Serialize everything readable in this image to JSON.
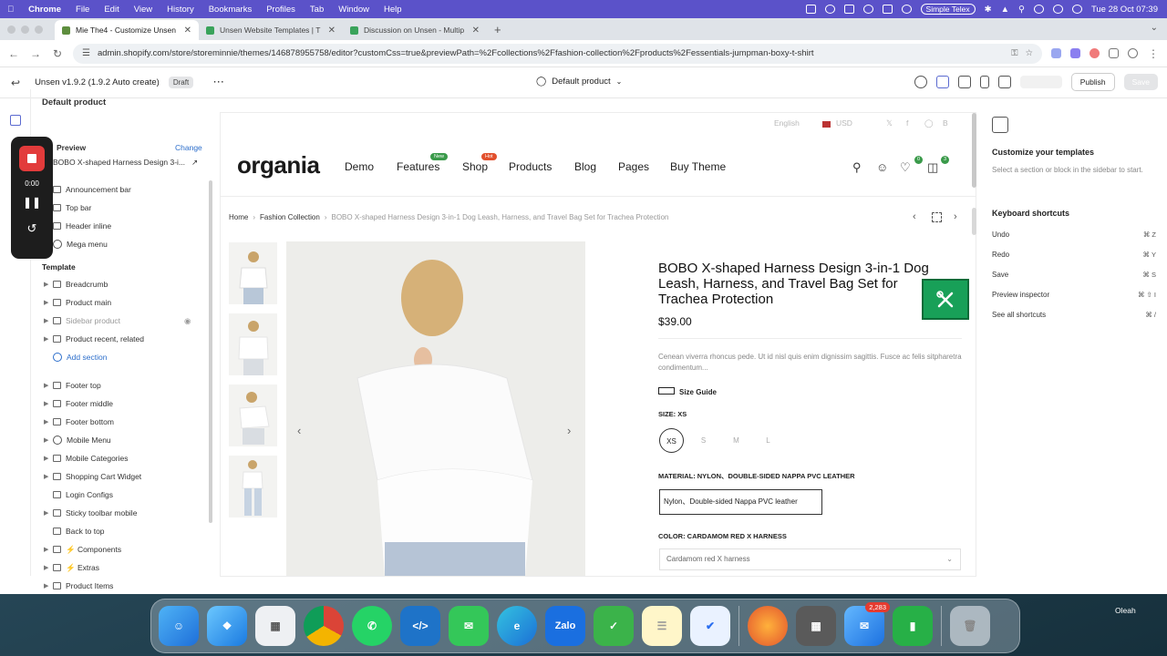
{
  "menubar": {
    "app": "Chrome",
    "items": [
      "File",
      "Edit",
      "View",
      "History",
      "Bookmarks",
      "Profiles",
      "Tab",
      "Window",
      "Help"
    ],
    "input_method": "Simple Telex",
    "datetime": "Tue 28 Oct  07:39"
  },
  "browser": {
    "tabs": [
      {
        "title": "Mie The4 - Customize Unsen",
        "active": true
      },
      {
        "title": "Unsen Website Templates | T",
        "active": false
      },
      {
        "title": "Discussion on Unsen - Multip",
        "active": false
      }
    ],
    "new_tab": "+",
    "url": "admin.shopify.com/store/storeminnie/themes/146878955758/editor?customCss=true&previewPath=%2Fcollections%2Ffashion-collection%2Fproducts%2Fessentials-jumpman-boxy-t-shirt"
  },
  "editor": {
    "theme_name": "Unsen v1.9.2 (1.9.2 Auto create)",
    "draft_badge": "Draft",
    "page_selector": "Default product",
    "publish_label": "Publish",
    "save_label": "Save"
  },
  "left_panel": {
    "title": "Default product",
    "preview_label": "Preview",
    "change_label": "Change",
    "preview_product": "BOBO X-shaped Harness Design 3-i...",
    "recorder_time": "0:00",
    "header_items": [
      "Announcement bar",
      "Top bar",
      "Header inline",
      "Mega menu"
    ],
    "template_label": "Template",
    "template_items": [
      "Breadcrumb",
      "Product main",
      "Sidebar product",
      "Product recent, related"
    ],
    "add_section": "Add section",
    "footer_items": [
      "Footer top",
      "Footer middle",
      "Footer bottom",
      "Mobile Menu",
      "Mobile Categories",
      "Shopping Cart Widget",
      "Login Configs",
      "Sticky toolbar mobile",
      "Back to top",
      "⚡ Components",
      "⚡ Extras",
      "Product Items"
    ]
  },
  "store": {
    "language": "English",
    "currency": "USD",
    "logo": "organia",
    "nav": [
      "Demo",
      "Features",
      "Shop",
      "Products",
      "Blog",
      "Pages",
      "Buy Theme"
    ],
    "badge_new": "New",
    "badge_hot": "Hot",
    "wishlist_count": "0",
    "cart_count": "3",
    "breadcrumb": [
      "Home",
      "Fashion Collection",
      "BOBO X-shaped Harness Design 3-in-1 Dog Leash, Harness, and Travel Bag Set for Trachea Protection"
    ]
  },
  "product": {
    "title": "BOBO X-shaped Harness Design 3-in-1 Dog Leash, Harness, and Travel Bag Set for Trachea Protection",
    "price": "$39.00",
    "description": "Cenean viverra rhoncus pede. Ut id nisl quis enim dignissim sagittis. Fusce ac felis sitpharetra condimentum...",
    "size_guide": "Size Guide",
    "size_label": "SIZE: XS",
    "sizes": [
      "XS",
      "S",
      "M",
      "L"
    ],
    "material_label": "MATERIAL: NYLON、DOUBLE-SIDED NAPPA PVC LEATHER",
    "material_option": "Nylon、Double-sided Nappa PVC leather",
    "color_label": "COLOR: CARDAMOM RED X HARNESS",
    "color_option": "Cardamom red X harness"
  },
  "right_panel": {
    "title": "Customize your templates",
    "hint": "Select a section or block in the sidebar to start.",
    "shortcuts_title": "Keyboard shortcuts",
    "shortcuts": [
      {
        "label": "Undo",
        "keys": "⌘  Z"
      },
      {
        "label": "Redo",
        "keys": "⌘  Y"
      },
      {
        "label": "Save",
        "keys": "⌘  S"
      },
      {
        "label": "Preview inspector",
        "keys": "⌘ ⇧ I"
      },
      {
        "label": "See all shortcuts",
        "keys": "⌘  /"
      }
    ]
  },
  "dock": {
    "mail_badge": "2,283",
    "zalo_label": "Zalo",
    "user_label": "Oleah"
  },
  "colors": {
    "menubar": "#5b52c9",
    "shopify_green": "#18a058",
    "accent_link": "#2c6ecb"
  }
}
